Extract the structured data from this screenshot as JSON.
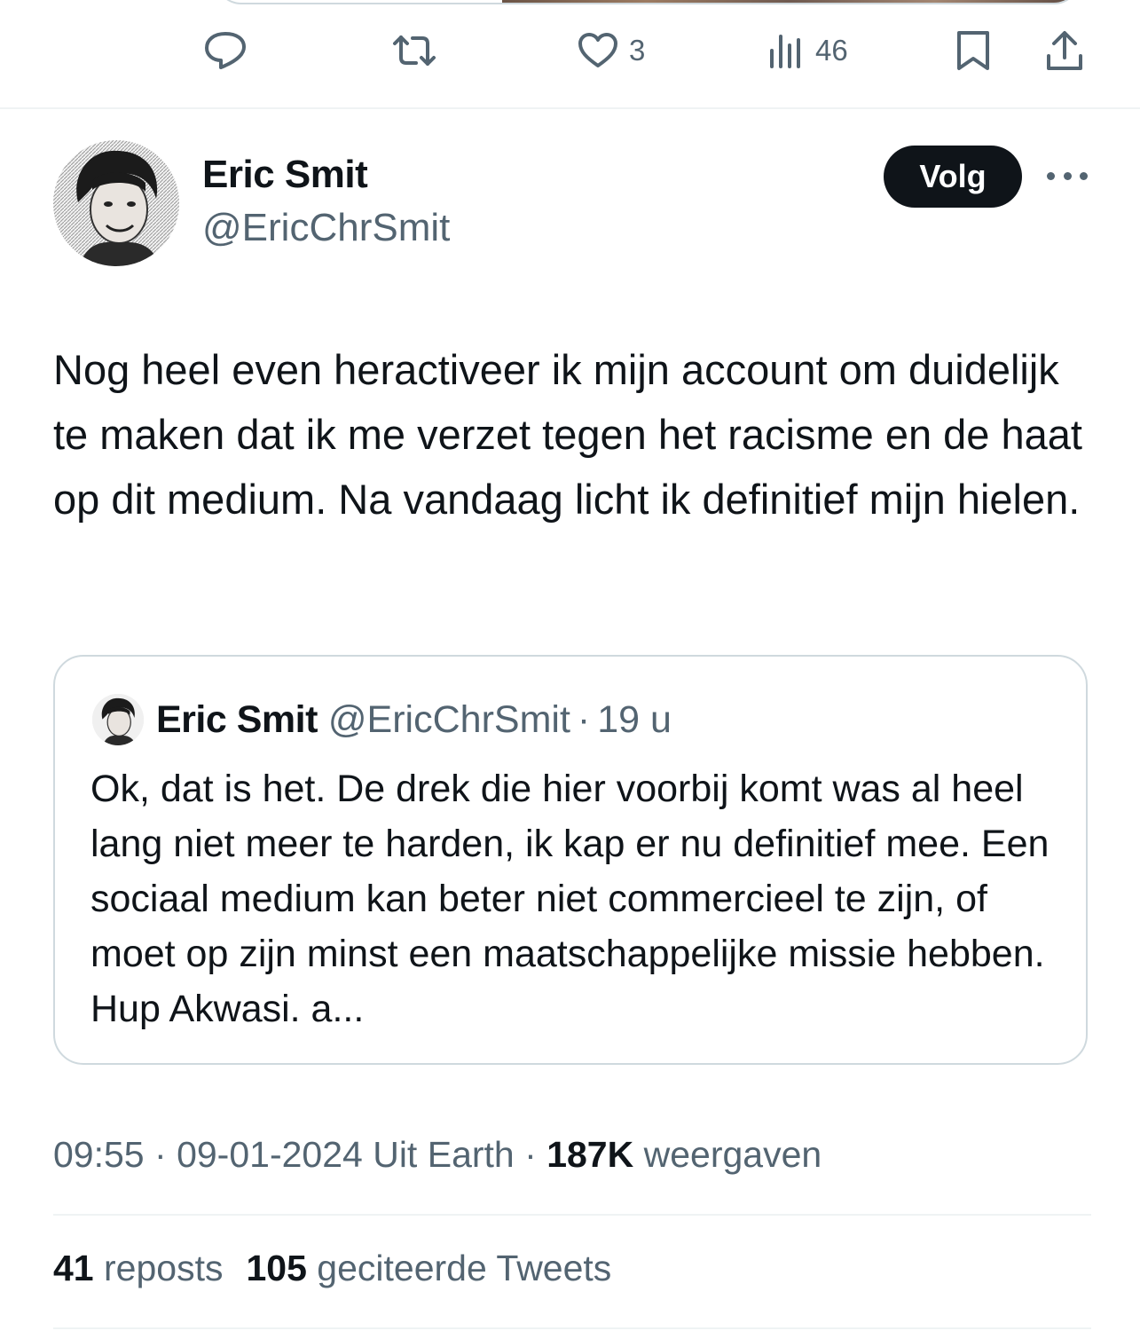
{
  "previous_tweet": {
    "actions": {
      "reply_icon": "reply-icon",
      "repost_icon": "repost-icon",
      "like_icon": "heart-icon",
      "like_count": "3",
      "views_icon": "views-icon",
      "views_count": "46",
      "bookmark_icon": "bookmark-icon",
      "share_icon": "share-icon"
    }
  },
  "tweet": {
    "author": {
      "name": "Eric Smit",
      "handle": "@EricChrSmit"
    },
    "follow_label": "Volg",
    "text": "Nog heel even heractiveer ik mijn account om duidelijk te maken dat ik me verzet tegen het racisme en de haat op dit medium. Na vandaag licht ik definitief mijn hielen.",
    "quoted": {
      "name": "Eric Smit",
      "handle": "@EricChrSmit",
      "separator": "·",
      "time": "19 u",
      "text": "Ok, dat is het. De drek die hier voorbij komt was al heel lang niet meer te harden, ik kap er nu definitief mee. Een sociaal medium kan beter niet commercieel te zijn, of moet op zijn minst een maatschappelijke missie hebben. Hup Akwasi. a..."
    },
    "meta": {
      "time": "09:55",
      "separator": "·",
      "date": "09-01-2024",
      "source": "Uit Earth",
      "separator2": "·",
      "views_count": "187K",
      "views_label": "weergaven"
    },
    "stats": {
      "reposts_count": "41",
      "reposts_label": "reposts",
      "quotes_count": "105",
      "quotes_label": "geciteerde Tweets"
    }
  },
  "colors": {
    "text_primary": "#0f1419",
    "text_secondary": "#536471",
    "border": "#cfd9de",
    "divider": "#eff3f4",
    "button_bg": "#0f1419"
  }
}
